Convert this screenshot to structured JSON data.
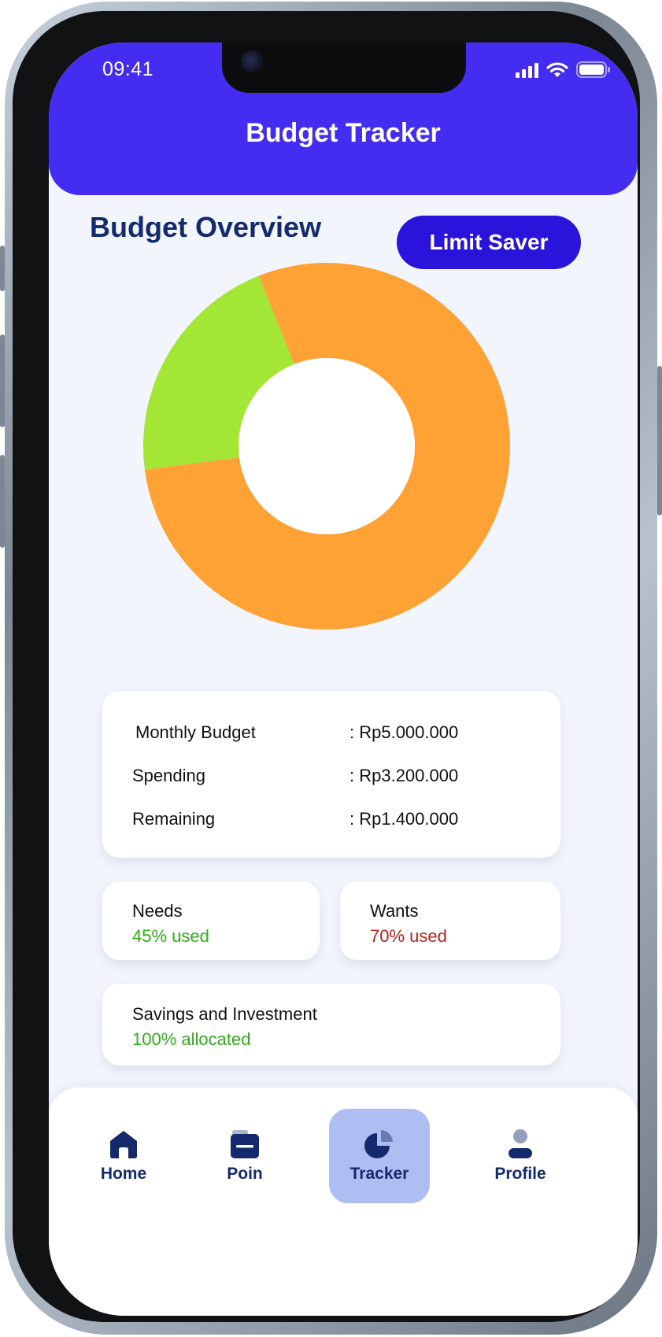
{
  "status_bar": {
    "time": "09:41"
  },
  "header": {
    "title": "Budget Tracker"
  },
  "overview": {
    "title": "Budget Overview",
    "limit_saver_label": "Limit Saver"
  },
  "chart_data": {
    "type": "pie",
    "slices": [
      {
        "value": 79,
        "color": "#ffa236"
      },
      {
        "value": 21,
        "color": "#a3e635"
      }
    ]
  },
  "summary": {
    "rows": [
      {
        "label": "Monthly Budget",
        "value": ": Rp5.000.000"
      },
      {
        "label": "Spending",
        "value": ": Rp3.200.000"
      },
      {
        "label": "Remaining",
        "value": ": Rp1.400.000"
      }
    ]
  },
  "categories": {
    "needs": {
      "label": "Needs",
      "status": "45% used"
    },
    "wants": {
      "label": "Wants",
      "status": "70% used"
    },
    "savings": {
      "label": "Savings and Investment",
      "status": "100% allocated"
    }
  },
  "nav": {
    "items": [
      {
        "label": "Home",
        "icon": "home-icon"
      },
      {
        "label": "Poin",
        "icon": "wallet-icon"
      },
      {
        "label": "Tracker",
        "icon": "pie-chart-icon",
        "active": true
      },
      {
        "label": "Profile",
        "icon": "user-icon"
      }
    ]
  },
  "colors": {
    "primary": "#442cf0",
    "button": "#2a14db",
    "navy": "#142a6c",
    "active_nav_bg": "#aebdf2",
    "green": "#2fae15",
    "red": "#c0201b"
  }
}
